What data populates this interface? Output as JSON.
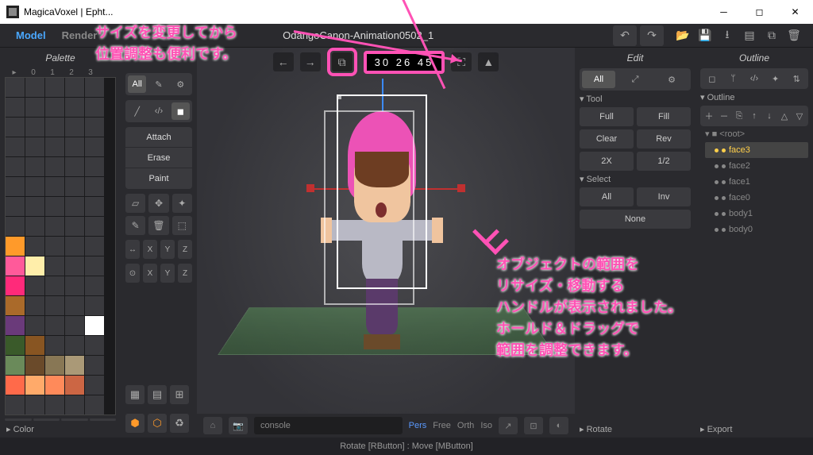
{
  "window": {
    "title": "MagicaVoxel | Epht..."
  },
  "tabs": {
    "model": "Model",
    "render": "Render"
  },
  "file": {
    "name": "OdangoCanon-Animation0502_1"
  },
  "toolbar_icons": [
    "undo",
    "redo",
    "open",
    "save",
    "import",
    "new",
    "copy",
    "delete"
  ],
  "dims": {
    "x": "30",
    "y": "26",
    "z": "45"
  },
  "palette": {
    "title": "Palette",
    "headers": [
      "▸",
      "0",
      "1",
      "2",
      "3"
    ],
    "collapse": "▸ Color",
    "swatches": [
      "#3a3a3e",
      "#3a3a3e",
      "#3a3a3e",
      "#3a3a3e",
      "#3a3a3e",
      "#3a3a3e",
      "#3a3a3e",
      "#3a3a3e",
      "#3a3a3e",
      "#3a3a3e",
      "#3a3a3e",
      "#3a3a3e",
      "#3a3a3e",
      "#3a3a3e",
      "#3a3a3e",
      "#3a3a3e",
      "#3a3a3e",
      "#3a3a3e",
      "#3a3a3e",
      "#3a3a3e",
      "#3a3a3e",
      "#3a3a3e",
      "#3a3a3e",
      "#3a3a3e",
      "#3a3a3e",
      "#3a3a3e",
      "#3a3a3e",
      "#3a3a3e",
      "#3a3a3e",
      "#3a3a3e",
      "#3a3a3e",
      "#3a3a3e",
      "#3a3a3e",
      "#3a3a3e",
      "#3a3a3e",
      "#3a3a3e",
      "#3a3a3e",
      "#3a3a3e",
      "#3a3a3e",
      "#3a3a3e",
      "#ff9a2a",
      "#3a3a3e",
      "#3a3a3e",
      "#3a3a3e",
      "#3a3a3e",
      "#ff5a9a",
      "#ffeeaa",
      "#3a3a3e",
      "#3a3a3e",
      "#3a3a3e",
      "#ff2a7a",
      "#3a3a3e",
      "#3a3a3e",
      "#3a3a3e",
      "#3a3a3e",
      "#aa6a2a",
      "#3a3a3e",
      "#3a3a3e",
      "#3a3a3e",
      "#3a3a3e",
      "#6a3a7a",
      "#3a3a3e",
      "#3a3a3e",
      "#3a3a3e",
      "#ffffff",
      "#3a5a2a",
      "#885522",
      "#3a3a3e",
      "#3a3a3e",
      "#3a3a3e",
      "#6a8a5a",
      "#6a4a2a",
      "#887755",
      "#aa9977",
      "#3a3a3e",
      "#ff6a4a",
      "#ffaa6a",
      "#ff8a5a",
      "#cc6644",
      "#3a3a3e",
      "#3a3a3e",
      "#3a3a3e",
      "#3a3a3e",
      "#3a3a3e",
      "#3a3a3e"
    ]
  },
  "brush": {
    "all": "All",
    "modes": {
      "attach": "Attach",
      "erase": "Erase",
      "paint": "Paint"
    },
    "mirror_label": "↔",
    "axis": [
      "X",
      "Y",
      "Z"
    ]
  },
  "viewport": {
    "console_placeholder": "console",
    "proj": {
      "pers": "Pers",
      "free": "Free",
      "orth": "Orth",
      "iso": "Iso"
    },
    "hint": "Rotate [RButton] : Move [MButton]"
  },
  "edit": {
    "title": "Edit",
    "all": "All",
    "tool_head": "▾ Tool",
    "tool": {
      "full": "Full",
      "fill": "Fill",
      "clear": "Clear",
      "rev": "Rev",
      "x2": "2X",
      "half": "1/2"
    },
    "select_head": "▾ Select",
    "select": {
      "all": "All",
      "inv": "Inv",
      "none": "None"
    },
    "rotate_head": "▸ Rotate"
  },
  "outline": {
    "title": "Outline",
    "head": "▾ Outline",
    "root": "▾ ■ <root>",
    "nodes": [
      "face3",
      "face2",
      "face1",
      "face0",
      "body1",
      "body0"
    ],
    "export_head": "▸ Export"
  },
  "annotations": {
    "top1": "サイズを変更してから",
    "top2": "位置調整も便利です。",
    "r1": "オブジェクトの範囲を",
    "r2": "リサイズ・移動する",
    "r3": "ハンドルが表示されました。",
    "r4": "ホールド＆ドラッグで",
    "r5": "範囲を調整できます。"
  }
}
